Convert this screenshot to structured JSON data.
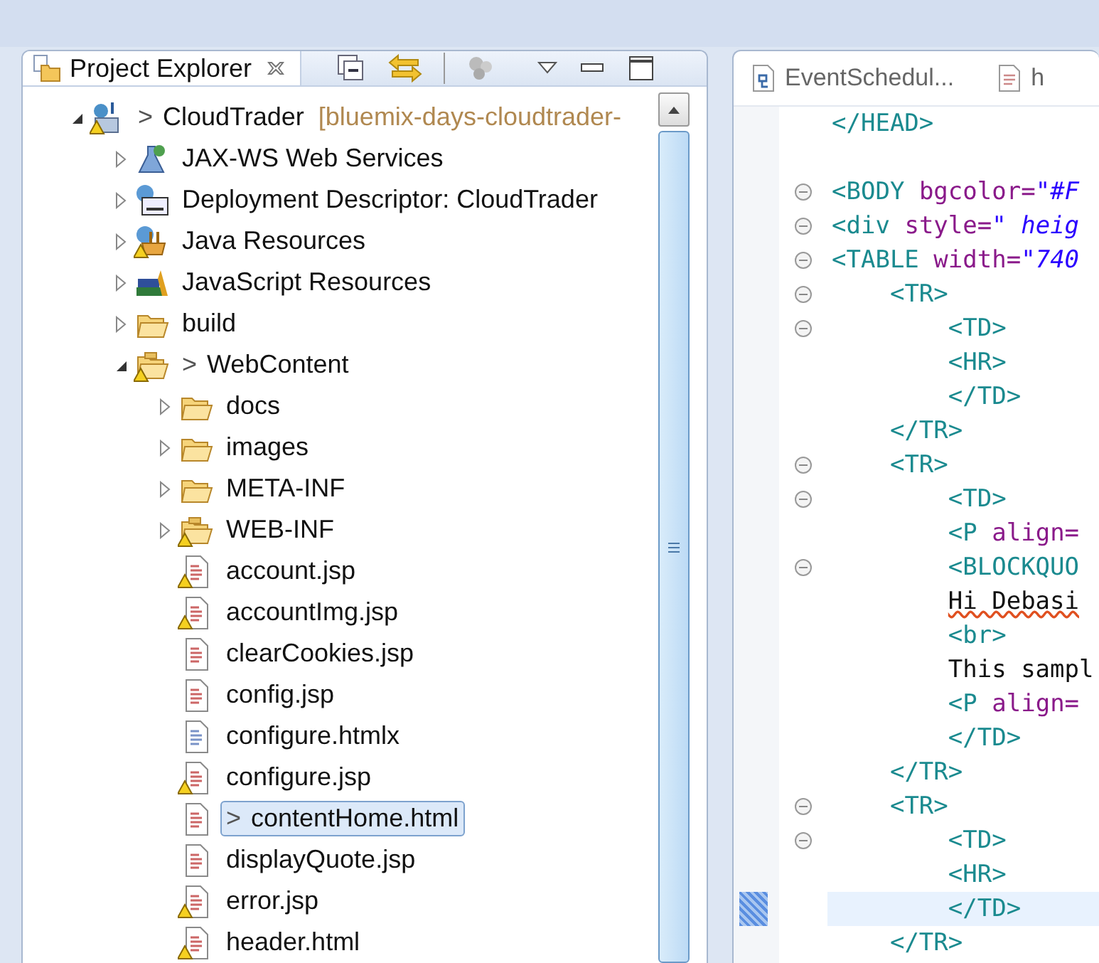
{
  "explorer": {
    "title": "Project Explorer",
    "selected": true,
    "tree": [
      {
        "label": "CloudTrader",
        "marker": ">",
        "decoration": "[bluemix-days-cloudtrader-",
        "kind": "project",
        "warning": true,
        "expanded": true,
        "selected": false,
        "children": [
          {
            "label": "JAX-WS Web Services",
            "kind": "services",
            "expanded": false,
            "selected": false
          },
          {
            "label": "Deployment Descriptor: CloudTrader",
            "kind": "descriptor",
            "expanded": false,
            "selected": false
          },
          {
            "label": "Java Resources",
            "kind": "resources",
            "warning": true,
            "expanded": false,
            "selected": false
          },
          {
            "label": "JavaScript Resources",
            "kind": "library",
            "expanded": false,
            "selected": false
          },
          {
            "label": "build",
            "kind": "folder",
            "expanded": false,
            "selected": false
          },
          {
            "label": "WebContent",
            "marker": ">",
            "kind": "webfolder",
            "warning": true,
            "expanded": true,
            "selected": false,
            "children": [
              {
                "label": "docs",
                "kind": "folder",
                "expanded": false,
                "selected": false
              },
              {
                "label": "images",
                "kind": "folder",
                "expanded": false,
                "selected": false
              },
              {
                "label": "META-INF",
                "kind": "folder",
                "expanded": false,
                "selected": false
              },
              {
                "label": "WEB-INF",
                "kind": "webfolder",
                "warning": true,
                "expanded": false,
                "selected": false
              },
              {
                "label": "account.jsp",
                "kind": "page",
                "warning": true,
                "selected": false
              },
              {
                "label": "accountImg.jsp",
                "kind": "page",
                "warning": true,
                "selected": false
              },
              {
                "label": "clearCookies.jsp",
                "kind": "page",
                "selected": false
              },
              {
                "label": "config.jsp",
                "kind": "page",
                "selected": false
              },
              {
                "label": "configure.htmlx",
                "kind": "document",
                "selected": false
              },
              {
                "label": "configure.jsp",
                "kind": "page",
                "warning": true,
                "selected": false
              },
              {
                "label": "contentHome.html",
                "marker": ">",
                "kind": "page",
                "selected": true
              },
              {
                "label": "displayQuote.jsp",
                "kind": "page",
                "selected": false
              },
              {
                "label": "error.jsp",
                "kind": "page",
                "warning": true,
                "selected": false
              },
              {
                "label": "header.html",
                "kind": "page",
                "warning": true,
                "selected": false
              }
            ]
          }
        ]
      }
    ]
  },
  "editor": {
    "tabs": [
      {
        "label": "EventSchedul...",
        "kind": "class",
        "selected": false
      },
      {
        "label": "h",
        "kind": "page",
        "selected": false
      }
    ],
    "lines": [
      {
        "fold": false,
        "current": false,
        "tokens": [
          {
            "kind": "tag",
            "text": "</HEAD>"
          }
        ]
      },
      {
        "fold": false,
        "current": false
      },
      {
        "fold": true,
        "current": false,
        "tokens": [
          {
            "kind": "tag",
            "text": "<BODY"
          },
          {
            "kind": "attr",
            "text": " bgcolor="
          },
          {
            "kind": "value",
            "text": "\"#F"
          }
        ]
      },
      {
        "fold": true,
        "current": false,
        "tokens": [
          {
            "kind": "tag",
            "text": "<div"
          },
          {
            "kind": "attr",
            "text": " style="
          },
          {
            "kind": "value",
            "text": "\" heig"
          }
        ]
      },
      {
        "fold": true,
        "current": false,
        "tokens": [
          {
            "kind": "tag",
            "text": "<TABLE"
          },
          {
            "kind": "attr",
            "text": " width="
          },
          {
            "kind": "value",
            "text": "\"740"
          }
        ]
      },
      {
        "fold": true,
        "current": false,
        "tokens": [
          {
            "kind": "tag",
            "text": "    <TR>"
          }
        ]
      },
      {
        "fold": true,
        "current": false,
        "tokens": [
          {
            "kind": "tag",
            "text": "        <TD>"
          }
        ]
      },
      {
        "fold": false,
        "current": false,
        "tokens": [
          {
            "kind": "tag",
            "text": "        <HR>"
          }
        ]
      },
      {
        "fold": false,
        "current": false,
        "tokens": [
          {
            "kind": "tag",
            "text": "        </TD>"
          }
        ]
      },
      {
        "fold": false,
        "current": false,
        "tokens": [
          {
            "kind": "tag",
            "text": "    </TR>"
          }
        ]
      },
      {
        "fold": true,
        "current": false,
        "tokens": [
          {
            "kind": "tag",
            "text": "    <TR>"
          }
        ]
      },
      {
        "fold": true,
        "current": false,
        "tokens": [
          {
            "kind": "tag",
            "text": "        <TD>"
          }
        ]
      },
      {
        "fold": false,
        "current": false,
        "tokens": [
          {
            "kind": "tag",
            "text": "        <P"
          },
          {
            "kind": "attr",
            "text": " align="
          }
        ]
      },
      {
        "fold": true,
        "current": false,
        "tokens": [
          {
            "kind": "tag",
            "text": "        <BLOCKQUO"
          }
        ]
      },
      {
        "fold": false,
        "current": false,
        "tokens": [
          {
            "kind": "text",
            "text": "        Hi Debasi",
            "misspelled": true
          }
        ]
      },
      {
        "fold": false,
        "current": false,
        "tokens": [
          {
            "kind": "tag",
            "text": "        <br>"
          }
        ]
      },
      {
        "fold": false,
        "current": false,
        "tokens": [
          {
            "kind": "text",
            "text": "        This sampl"
          }
        ]
      },
      {
        "fold": false,
        "current": false,
        "tokens": [
          {
            "kind": "tag",
            "text": "        <P"
          },
          {
            "kind": "attr",
            "text": " align="
          }
        ]
      },
      {
        "fold": false,
        "current": false,
        "tokens": [
          {
            "kind": "tag",
            "text": "        </TD>"
          }
        ]
      },
      {
        "fold": false,
        "current": false,
        "tokens": [
          {
            "kind": "tag",
            "text": "    </TR>"
          }
        ]
      },
      {
        "fold": true,
        "current": false,
        "tokens": [
          {
            "kind": "tag",
            "text": "    <TR>"
          }
        ]
      },
      {
        "fold": true,
        "current": false,
        "tokens": [
          {
            "kind": "tag",
            "text": "        <TD>"
          }
        ]
      },
      {
        "fold": false,
        "current": false,
        "tokens": [
          {
            "kind": "tag",
            "text": "        <HR>"
          }
        ]
      },
      {
        "fold": false,
        "current": true,
        "tokens": [
          {
            "kind": "tag",
            "text": "        </TD>"
          }
        ]
      },
      {
        "fold": false,
        "current": false,
        "tokens": [
          {
            "kind": "tag",
            "text": "    </TR>"
          }
        ]
      }
    ]
  }
}
